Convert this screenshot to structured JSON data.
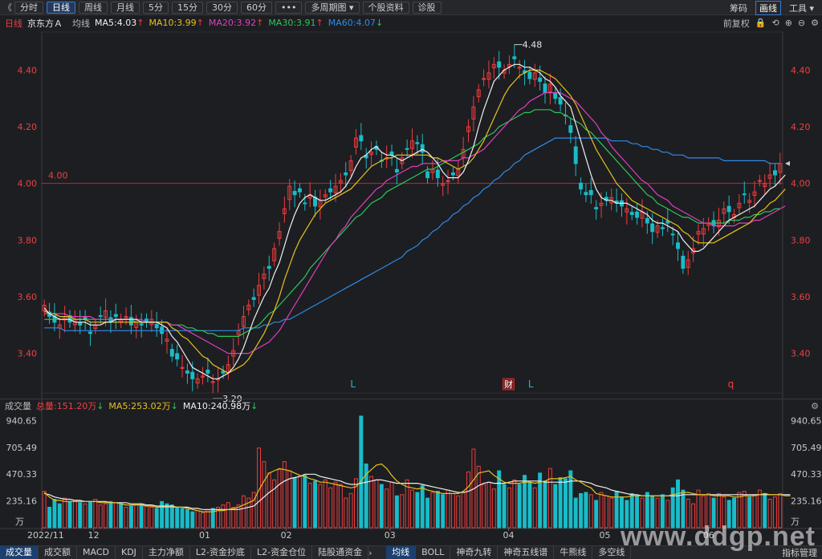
{
  "toolbar": {
    "back_glyph": "《",
    "tabs": [
      "分时",
      "日线",
      "周线",
      "月线",
      "5分",
      "15分",
      "30分",
      "60分",
      "•••",
      "多周期图 ▾",
      "个股资料",
      "诊股"
    ],
    "active_tab": "日线",
    "right": {
      "chips": "筹码",
      "draw": "画线",
      "tools": "工具 ▾"
    }
  },
  "infobar": {
    "period": "日线",
    "stock": "京东方Ａ",
    "avg": "均线",
    "ma5": "MA5:4.03",
    "ma10": "MA10:3.99",
    "ma20": "MA20:3.92",
    "ma30": "MA30:3.91",
    "ma60": "MA60:4.07",
    "restore": "前复权"
  },
  "colors": {
    "up": "#f03c3c",
    "down": "#19bcc8",
    "ma5": "#f0f0f0",
    "ma10": "#e6c21d",
    "ma20": "#dd3fbf",
    "ma30": "#2ec55a",
    "ma60": "#2e8be6",
    "refline": "#c62828",
    "axis": "#ef4040"
  },
  "volbar": {
    "title": "成交量",
    "total": "总量:151.20万",
    "ma5": "MA5:253.02万",
    "ma10": "MA10:240.98万"
  },
  "bottombar": {
    "tabs": [
      "成交量",
      "成交额",
      "MACD",
      "KDJ",
      "主力净额",
      "L2-资金抄底",
      "L2-资金仓位",
      "陆股通资金"
    ],
    "tabs2": [
      "均线",
      "BOLL",
      "神奇九转",
      "神奇五线谱",
      "牛熊线",
      "多空线"
    ],
    "right": "指标管理"
  },
  "watermark": "www.ddgp.net",
  "chart_data": {
    "type": "candlestick",
    "ylim": [
      3.26,
      4.52
    ],
    "price_ticks": [
      "4.40",
      "4.20",
      "4.00",
      "3.80",
      "3.60",
      "3.40"
    ],
    "ref_line": {
      "value": 4.0,
      "label": "4.00"
    },
    "high_label": "4.48",
    "low_label": "3.29",
    "markers": [
      "L",
      "财",
      "L",
      "q"
    ],
    "x_labels": [
      "2022/11",
      "12",
      "01",
      "02",
      "03",
      "04",
      "05",
      "06"
    ],
    "vol_ticks": [
      "940.65",
      "705.49",
      "470.33",
      "235.16"
    ],
    "vol_unit": "万",
    "vol_max": 1000,
    "closes": [
      3.57,
      3.53,
      3.51,
      3.5,
      3.53,
      3.51,
      3.52,
      3.5,
      3.52,
      3.47,
      3.5,
      3.53,
      3.55,
      3.51,
      3.53,
      3.52,
      3.53,
      3.5,
      3.51,
      3.5,
      3.51,
      3.52,
      3.49,
      3.47,
      3.45,
      3.39,
      3.38,
      3.35,
      3.33,
      3.31,
      3.31,
      3.32,
      3.33,
      3.3,
      3.31,
      3.33,
      3.36,
      3.41,
      3.48,
      3.53,
      3.57,
      3.59,
      3.64,
      3.68,
      3.7,
      3.77,
      3.83,
      3.91,
      3.99,
      3.96,
      3.97,
      3.93,
      3.96,
      3.92,
      3.94,
      3.96,
      3.97,
      3.99,
      4.01,
      4.03,
      4.08,
      4.16,
      4.15,
      4.09,
      4.11,
      4.12,
      4.08,
      4.09,
      4.1,
      4.04,
      4.09,
      4.12,
      4.15,
      4.14,
      4.11,
      4.02,
      4.05,
      4.02,
      4.0,
      4.01,
      4.03,
      4.05,
      4.12,
      4.2,
      4.27,
      4.33,
      4.37,
      4.39,
      4.42,
      4.41,
      4.4,
      4.42,
      4.44,
      4.41,
      4.39,
      4.37,
      4.39,
      4.36,
      4.32,
      4.35,
      4.3,
      4.28,
      4.24,
      4.18,
      4.07,
      3.98,
      3.96,
      3.96,
      3.91,
      3.93,
      3.94,
      3.95,
      3.93,
      3.92,
      3.91,
      3.89,
      3.88,
      3.9,
      3.86,
      3.83,
      3.85,
      3.84,
      3.86,
      3.82,
      3.77,
      3.7,
      3.73,
      3.77,
      3.83,
      3.84,
      3.86,
      3.85,
      3.87,
      3.91,
      3.9,
      3.89,
      3.93,
      3.96,
      3.94,
      3.97,
      4.01,
      4.0,
      4.03,
      4.03,
      4.07
    ],
    "ma5": [
      3.56,
      3.54,
      3.53,
      3.52,
      3.52,
      3.52,
      3.51,
      3.51,
      3.51,
      3.5,
      3.5,
      3.5,
      3.51,
      3.51,
      3.52,
      3.52,
      3.52,
      3.52,
      3.52,
      3.51,
      3.51,
      3.51,
      3.51,
      3.5,
      3.49,
      3.46,
      3.44,
      3.41,
      3.38,
      3.35,
      3.34,
      3.33,
      3.32,
      3.31,
      3.31,
      3.32,
      3.33,
      3.35,
      3.38,
      3.42,
      3.47,
      3.52,
      3.56,
      3.6,
      3.63,
      3.68,
      3.72,
      3.78,
      3.84,
      3.89,
      3.93,
      3.95,
      3.96,
      3.95,
      3.94,
      3.94,
      3.95,
      3.96,
      3.97,
      3.99,
      4.02,
      4.06,
      4.09,
      4.1,
      4.12,
      4.13,
      4.11,
      4.1,
      4.1,
      4.09,
      4.08,
      4.09,
      4.1,
      4.11,
      4.12,
      4.11,
      4.09,
      4.07,
      4.04,
      4.02,
      4.02,
      4.02,
      4.04,
      4.08,
      4.13,
      4.2,
      4.26,
      4.31,
      4.36,
      4.38,
      4.4,
      4.41,
      4.42,
      4.42,
      4.41,
      4.41,
      4.4,
      4.39,
      4.37,
      4.36,
      4.34,
      4.31,
      4.29,
      4.27,
      4.21,
      4.15,
      4.09,
      4.03,
      3.98,
      3.95,
      3.94,
      3.94,
      3.93,
      3.93,
      3.93,
      3.92,
      3.91,
      3.9,
      3.89,
      3.87,
      3.86,
      3.86,
      3.85,
      3.84,
      3.83,
      3.8,
      3.78,
      3.76,
      3.76,
      3.77,
      3.79,
      3.81,
      3.83,
      3.85,
      3.87,
      3.88,
      3.89,
      3.9,
      3.91,
      3.92,
      3.94,
      3.96,
      3.98,
      3.99,
      4.01,
      4.03
    ],
    "ma10": [
      3.55,
      3.54,
      3.54,
      3.53,
      3.53,
      3.53,
      3.52,
      3.52,
      3.52,
      3.51,
      3.51,
      3.51,
      3.51,
      3.51,
      3.51,
      3.51,
      3.51,
      3.51,
      3.51,
      3.51,
      3.51,
      3.51,
      3.51,
      3.51,
      3.51,
      3.49,
      3.48,
      3.46,
      3.45,
      3.43,
      3.41,
      3.39,
      3.38,
      3.36,
      3.35,
      3.34,
      3.33,
      3.34,
      3.35,
      3.36,
      3.38,
      3.41,
      3.44,
      3.47,
      3.51,
      3.55,
      3.6,
      3.66,
      3.71,
      3.76,
      3.8,
      3.83,
      3.86,
      3.89,
      3.91,
      3.93,
      3.94,
      3.95,
      3.96,
      3.97,
      3.98,
      4.0,
      4.02,
      4.04,
      4.06,
      4.07,
      4.08,
      4.09,
      4.09,
      4.1,
      4.1,
      4.1,
      4.1,
      4.1,
      4.1,
      4.1,
      4.09,
      4.09,
      4.08,
      4.07,
      4.06,
      4.05,
      4.06,
      4.07,
      4.09,
      4.12,
      4.15,
      4.19,
      4.23,
      4.27,
      4.31,
      4.34,
      4.36,
      4.38,
      4.39,
      4.4,
      4.4,
      4.4,
      4.39,
      4.38,
      4.37,
      4.35,
      4.33,
      4.31,
      4.28,
      4.24,
      4.2,
      4.16,
      4.12,
      4.09,
      4.06,
      4.03,
      4.0,
      3.98,
      3.96,
      3.94,
      3.93,
      3.92,
      3.91,
      3.9,
      3.89,
      3.88,
      3.87,
      3.86,
      3.85,
      3.83,
      3.82,
      3.8,
      3.79,
      3.79,
      3.79,
      3.79,
      3.8,
      3.81,
      3.82,
      3.83,
      3.84,
      3.85,
      3.86,
      3.88,
      3.9,
      3.91,
      3.93,
      3.94,
      3.96,
      3.98
    ],
    "ma20": [
      3.54,
      3.54,
      3.54,
      3.54,
      3.54,
      3.53,
      3.53,
      3.53,
      3.53,
      3.53,
      3.52,
      3.52,
      3.52,
      3.52,
      3.52,
      3.52,
      3.52,
      3.52,
      3.52,
      3.52,
      3.51,
      3.51,
      3.51,
      3.51,
      3.51,
      3.5,
      3.5,
      3.49,
      3.48,
      3.47,
      3.46,
      3.45,
      3.44,
      3.43,
      3.42,
      3.41,
      3.4,
      3.4,
      3.4,
      3.4,
      3.4,
      3.41,
      3.42,
      3.43,
      3.44,
      3.46,
      3.48,
      3.51,
      3.54,
      3.57,
      3.6,
      3.63,
      3.66,
      3.69,
      3.72,
      3.75,
      3.78,
      3.8,
      3.83,
      3.85,
      3.88,
      3.9,
      3.92,
      3.94,
      3.96,
      3.98,
      3.99,
      4.01,
      4.02,
      4.03,
      4.04,
      4.05,
      4.06,
      4.06,
      4.07,
      4.07,
      4.07,
      4.07,
      4.08,
      4.08,
      4.08,
      4.08,
      4.09,
      4.09,
      4.1,
      4.11,
      4.12,
      4.14,
      4.16,
      4.18,
      4.2,
      4.22,
      4.24,
      4.26,
      4.27,
      4.29,
      4.3,
      4.31,
      4.32,
      4.32,
      4.32,
      4.32,
      4.31,
      4.3,
      4.29,
      4.27,
      4.25,
      4.23,
      4.21,
      4.18,
      4.16,
      4.13,
      4.11,
      4.09,
      4.07,
      4.05,
      4.03,
      4.01,
      4.0,
      3.98,
      3.96,
      3.95,
      3.94,
      3.92,
      3.91,
      3.9,
      3.89,
      3.88,
      3.87,
      3.86,
      3.86,
      3.85,
      3.85,
      3.85,
      3.85,
      3.85,
      3.86,
      3.86,
      3.86,
      3.87,
      3.87,
      3.88,
      3.89,
      3.9,
      3.91,
      3.92
    ],
    "ma30": [
      3.52,
      3.52,
      3.52,
      3.52,
      3.52,
      3.52,
      3.52,
      3.52,
      3.52,
      3.52,
      3.52,
      3.52,
      3.52,
      3.52,
      3.52,
      3.52,
      3.52,
      3.52,
      3.51,
      3.51,
      3.51,
      3.51,
      3.51,
      3.51,
      3.51,
      3.5,
      3.5,
      3.5,
      3.49,
      3.49,
      3.48,
      3.48,
      3.47,
      3.47,
      3.46,
      3.46,
      3.46,
      3.46,
      3.46,
      3.47,
      3.48,
      3.49,
      3.5,
      3.52,
      3.54,
      3.55,
      3.57,
      3.59,
      3.61,
      3.63,
      3.65,
      3.67,
      3.7,
      3.72,
      3.74,
      3.76,
      3.78,
      3.8,
      3.82,
      3.84,
      3.86,
      3.88,
      3.89,
      3.91,
      3.93,
      3.94,
      3.95,
      3.97,
      3.98,
      3.99,
      4.0,
      4.01,
      4.02,
      4.03,
      4.04,
      4.05,
      4.05,
      4.06,
      4.07,
      4.08,
      4.09,
      4.1,
      4.11,
      4.12,
      4.13,
      4.14,
      4.16,
      4.17,
      4.18,
      4.2,
      4.21,
      4.22,
      4.23,
      4.24,
      4.25,
      4.25,
      4.26,
      4.26,
      4.26,
      4.26,
      4.25,
      4.25,
      4.24,
      4.23,
      4.22,
      4.21,
      4.19,
      4.18,
      4.16,
      4.14,
      4.12,
      4.1,
      4.08,
      4.06,
      4.04,
      4.02,
      4.0,
      3.98,
      3.96,
      3.95,
      3.93,
      3.92,
      3.91,
      3.9,
      3.89,
      3.88,
      3.88,
      3.87,
      3.86,
      3.86,
      3.86,
      3.86,
      3.86,
      3.86,
      3.87,
      3.87,
      3.87,
      3.88,
      3.88,
      3.89,
      3.89,
      3.9,
      3.9,
      3.91,
      3.91
    ],
    "ma60": [
      3.49,
      3.49,
      3.49,
      3.49,
      3.48,
      3.48,
      3.48,
      3.48,
      3.48,
      3.48,
      3.48,
      3.48,
      3.48,
      3.48,
      3.48,
      3.48,
      3.48,
      3.48,
      3.48,
      3.48,
      3.48,
      3.48,
      3.48,
      3.48,
      3.48,
      3.48,
      3.48,
      3.48,
      3.48,
      3.48,
      3.48,
      3.48,
      3.48,
      3.48,
      3.48,
      3.48,
      3.48,
      3.48,
      3.48,
      3.49,
      3.49,
      3.49,
      3.49,
      3.5,
      3.5,
      3.51,
      3.51,
      3.52,
      3.52,
      3.53,
      3.54,
      3.55,
      3.56,
      3.57,
      3.58,
      3.59,
      3.6,
      3.61,
      3.62,
      3.63,
      3.64,
      3.65,
      3.66,
      3.67,
      3.68,
      3.69,
      3.7,
      3.71,
      3.72,
      3.73,
      3.74,
      3.76,
      3.77,
      3.78,
      3.8,
      3.81,
      3.83,
      3.84,
      3.86,
      3.87,
      3.89,
      3.9,
      3.92,
      3.93,
      3.95,
      3.96,
      3.98,
      3.99,
      4.01,
      4.02,
      4.04,
      4.05,
      4.07,
      4.08,
      4.1,
      4.11,
      4.12,
      4.13,
      4.14,
      4.15,
      4.16,
      4.16,
      4.16,
      4.16,
      4.16,
      4.16,
      4.16,
      4.16,
      4.16,
      4.16,
      4.16,
      4.15,
      4.15,
      4.15,
      4.15,
      4.14,
      4.14,
      4.13,
      4.13,
      4.12,
      4.12,
      4.11,
      4.11,
      4.1,
      4.1,
      4.1,
      4.09,
      4.09,
      4.09,
      4.09,
      4.09,
      4.09,
      4.09,
      4.08,
      4.08,
      4.08,
      4.08,
      4.08,
      4.08,
      4.08,
      4.08,
      4.08,
      4.07,
      4.07,
      4.07
    ],
    "volumes": [
      320,
      180,
      250,
      210,
      260,
      230,
      240,
      220,
      210,
      230,
      250,
      200,
      210,
      230,
      220,
      210,
      180,
      190,
      200,
      210,
      190,
      180,
      170,
      230,
      210,
      200,
      180,
      170,
      160,
      140,
      150,
      130,
      160,
      170,
      180,
      200,
      220,
      180,
      200,
      280,
      260,
      310,
      700,
      580,
      480,
      420,
      510,
      580,
      500,
      440,
      450,
      460,
      390,
      410,
      380,
      420,
      350,
      400,
      380,
      260,
      300,
      430,
      980,
      560,
      450,
      420,
      380,
      340,
      400,
      280,
      290,
      420,
      330,
      310,
      370,
      260,
      310,
      320,
      290,
      330,
      300,
      280,
      310,
      490,
      690,
      540,
      380,
      400,
      340,
      500,
      380,
      350,
      420,
      380,
      460,
      400,
      350,
      480,
      410,
      520,
      380,
      440,
      430,
      500,
      260,
      300,
      310,
      290,
      240,
      310,
      280,
      260,
      320,
      270,
      240,
      300,
      280,
      260,
      310,
      280,
      260,
      290,
      240,
      350,
      420,
      330,
      250,
      210,
      330,
      280,
      300,
      260,
      300,
      270,
      240,
      260,
      310,
      320,
      270,
      290,
      330,
      300,
      250,
      270,
      300,
      260,
      300
    ],
    "vol_ma5": [
      310,
      270,
      240,
      240,
      230,
      230,
      230,
      230,
      230,
      230,
      230,
      220,
      220,
      220,
      220,
      210,
      200,
      200,
      200,
      200,
      190,
      190,
      180,
      180,
      180,
      180,
      180,
      180,
      170,
      160,
      150,
      140,
      140,
      140,
      150,
      150,
      160,
      170,
      180,
      200,
      220,
      240,
      330,
      410,
      480,
      500,
      520,
      510,
      500,
      480,
      460,
      450,
      430,
      420,
      400,
      400,
      390,
      380,
      370,
      360,
      350,
      360,
      410,
      470,
      510,
      550,
      560,
      520,
      460,
      410,
      380,
      360,
      350,
      340,
      350,
      330,
      320,
      310,
      300,
      300,
      300,
      300,
      320,
      360,
      420,
      480,
      490,
      500,
      460,
      430,
      400,
      390,
      390,
      390,
      400,
      400,
      390,
      400,
      410,
      430,
      430,
      430,
      440,
      450,
      420,
      400,
      370,
      350,
      300,
      290,
      280,
      270,
      270,
      270,
      270,
      280,
      280,
      280,
      280,
      280,
      280,
      280,
      280,
      290,
      300,
      310,
      310,
      300,
      290,
      290,
      290,
      280,
      280,
      280,
      280,
      270,
      270,
      280,
      280,
      280,
      290,
      300,
      290,
      290,
      290,
      280,
      280
    ],
    "vol_ma10": [
      300,
      290,
      270,
      260,
      250,
      250,
      240,
      240,
      230,
      230,
      230,
      230,
      230,
      220,
      220,
      220,
      220,
      210,
      210,
      210,
      200,
      200,
      190,
      190,
      190,
      190,
      180,
      180,
      180,
      170,
      170,
      160,
      160,
      160,
      160,
      160,
      160,
      160,
      160,
      170,
      180,
      190,
      230,
      270,
      310,
      340,
      380,
      410,
      430,
      440,
      450,
      470,
      470,
      470,
      450,
      440,
      430,
      420,
      410,
      390,
      380,
      380,
      390,
      400,
      410,
      420,
      420,
      410,
      400,
      390,
      390,
      390,
      390,
      390,
      380,
      370,
      360,
      350,
      340,
      330,
      320,
      310,
      310,
      320,
      340,
      370,
      390,
      400,
      390,
      390,
      390,
      400,
      410,
      410,
      410,
      410,
      410,
      410,
      400,
      400,
      400,
      400,
      400,
      410,
      410,
      410,
      400,
      390,
      370,
      360,
      350,
      330,
      320,
      310,
      300,
      290,
      290,
      280,
      280,
      280,
      280,
      280,
      280,
      280,
      280,
      290,
      290,
      290,
      290,
      290,
      290,
      290,
      290,
      290,
      290,
      290,
      290,
      290,
      290,
      290,
      290,
      290,
      290,
      290,
      290,
      290,
      290
    ]
  }
}
